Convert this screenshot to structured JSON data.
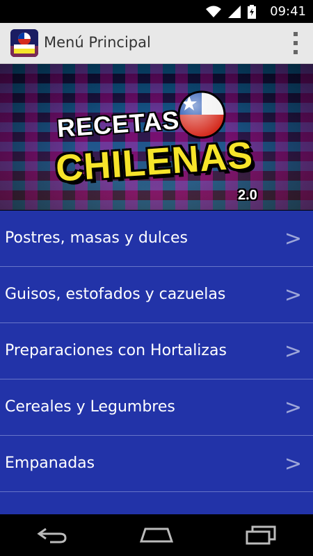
{
  "status_bar": {
    "time": "09:41",
    "icons": [
      "wifi-icon",
      "signal-icon",
      "battery-icon"
    ]
  },
  "action_bar": {
    "title": "Menú Principal",
    "overflow_icon": "overflow-menu-icon"
  },
  "banner": {
    "logo_line1": "RECETAS",
    "logo_line2": "CHILENAS",
    "logo_version": "2.0"
  },
  "menu": {
    "items": [
      {
        "label": "Postres, masas y dulces",
        "chevron": ">"
      },
      {
        "label": "Guisos, estofados y cazuelas",
        "chevron": ">"
      },
      {
        "label": "Preparaciones con Hortalizas",
        "chevron": ">"
      },
      {
        "label": "Cereales y Legumbres",
        "chevron": ">"
      },
      {
        "label": "Empanadas",
        "chevron": ">"
      },
      {
        "label": "",
        "chevron": ">"
      }
    ]
  },
  "colors": {
    "menu_bg": "#2233a8",
    "divider": "#6775c8",
    "action_bar_bg": "#e8e8e8"
  },
  "nav_bar": {
    "buttons": [
      "back-icon",
      "home-icon",
      "recents-icon"
    ]
  }
}
